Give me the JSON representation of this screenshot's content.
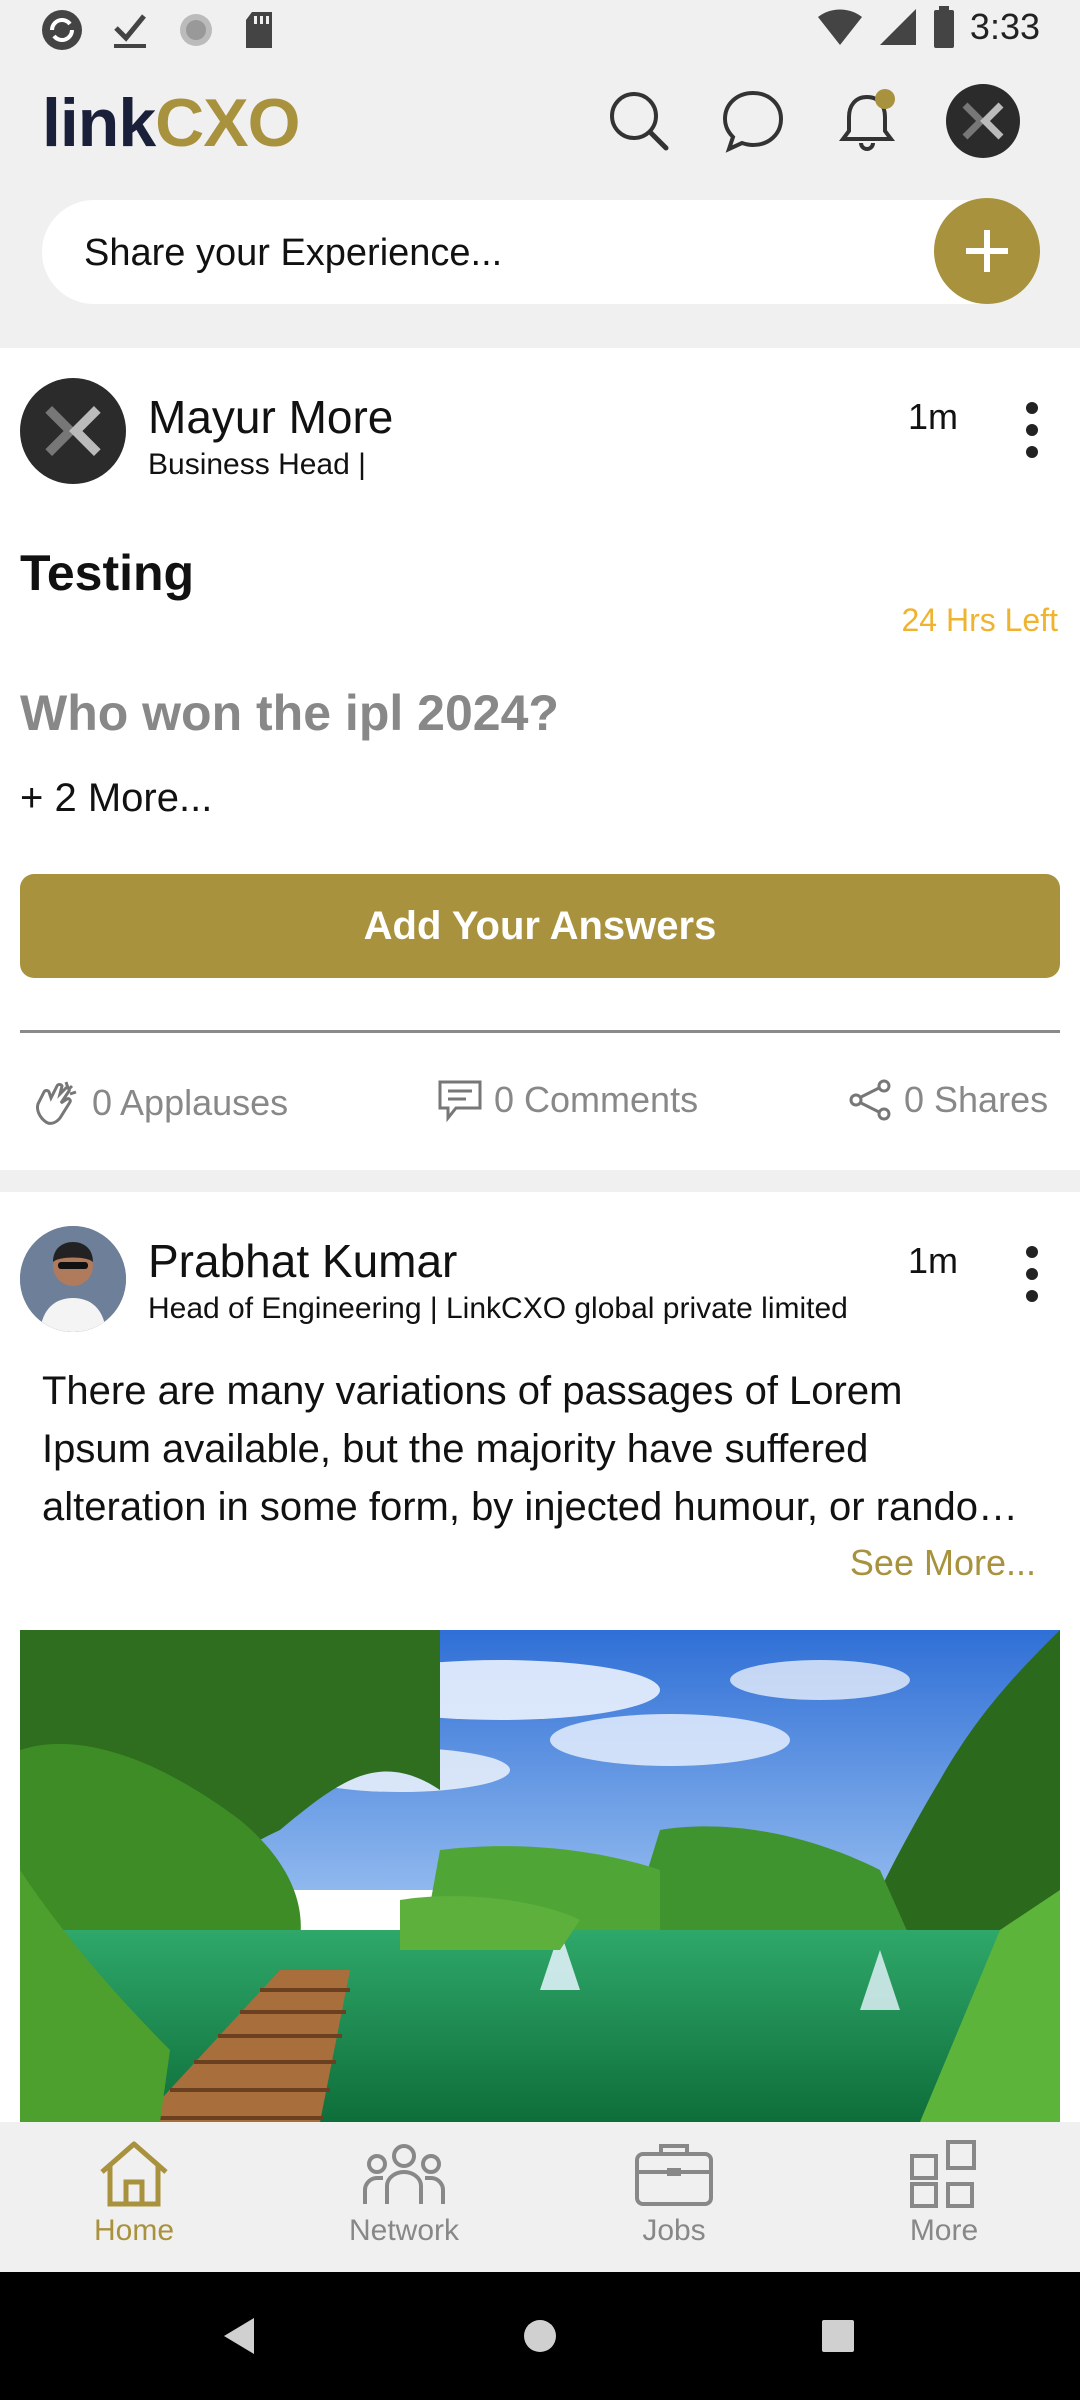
{
  "status_bar": {
    "time": "3:33"
  },
  "header": {
    "logo_link": "link",
    "logo_cxo": "CXO",
    "icons": [
      "search-icon",
      "chat-icon",
      "bell-icon",
      "profile-avatar"
    ]
  },
  "composer": {
    "placeholder": "Share your Experience..."
  },
  "posts": [
    {
      "author": "Mayur More",
      "subtitle": "Business Head |",
      "time": "1m",
      "poll_title": "Testing",
      "time_left": "24 Hrs Left",
      "question": "Who won the ipl 2024?",
      "more_options": "+ 2 More...",
      "answer_button": "Add Your Answers",
      "applauses": "0 Applauses",
      "comments": "0 Comments",
      "shares": "0 Shares"
    },
    {
      "author": "Prabhat Kumar",
      "subtitle": "Head of Engineering | LinkCXO global private limited",
      "time": "1m",
      "body_line1": "There are many variations of passages of Lorem",
      "body_line2": "Ipsum available, but the majority have suffered",
      "body_line3": "alteration in some form, by injected humour, or randomised words",
      "see_more": "See More..."
    }
  ],
  "bottom_nav": {
    "home": "Home",
    "network": "Network",
    "jobs": "Jobs",
    "more": "More",
    "active": "Home"
  },
  "colors": {
    "accent": "#a8923e",
    "brand_dark": "#1a1f3a",
    "warning": "#f0b330"
  }
}
